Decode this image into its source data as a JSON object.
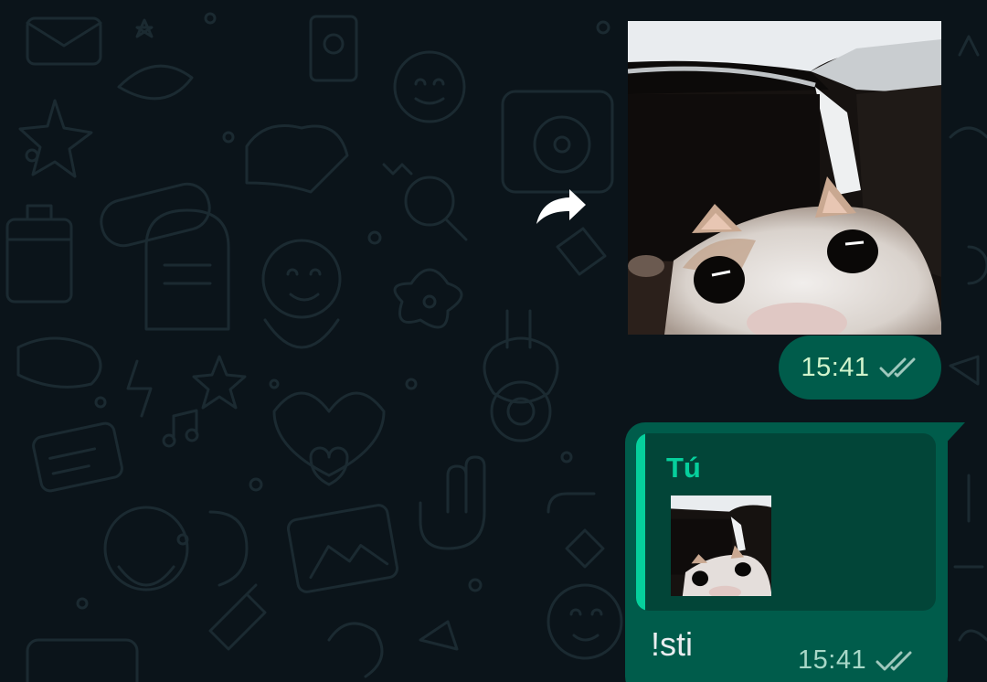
{
  "colors": {
    "background": "#0b141a",
    "outgoing_bubble": "#005c4b",
    "quote_background": "#024538",
    "quote_accent": "#06cf9c",
    "text_primary": "#e9edef",
    "timestamp": "#d1f4cc"
  },
  "conversation": {
    "forward_icon": "forward-arrow-icon",
    "sticker_message": {
      "content_type": "sticker",
      "time": "15:41",
      "status_icon": "double-check-icon"
    },
    "reply_message": {
      "quoted": {
        "author": "Tú",
        "media": "sticker-thumbnail"
      },
      "text": "!sti",
      "time": "15:41",
      "status_icon": "double-check-icon"
    }
  }
}
